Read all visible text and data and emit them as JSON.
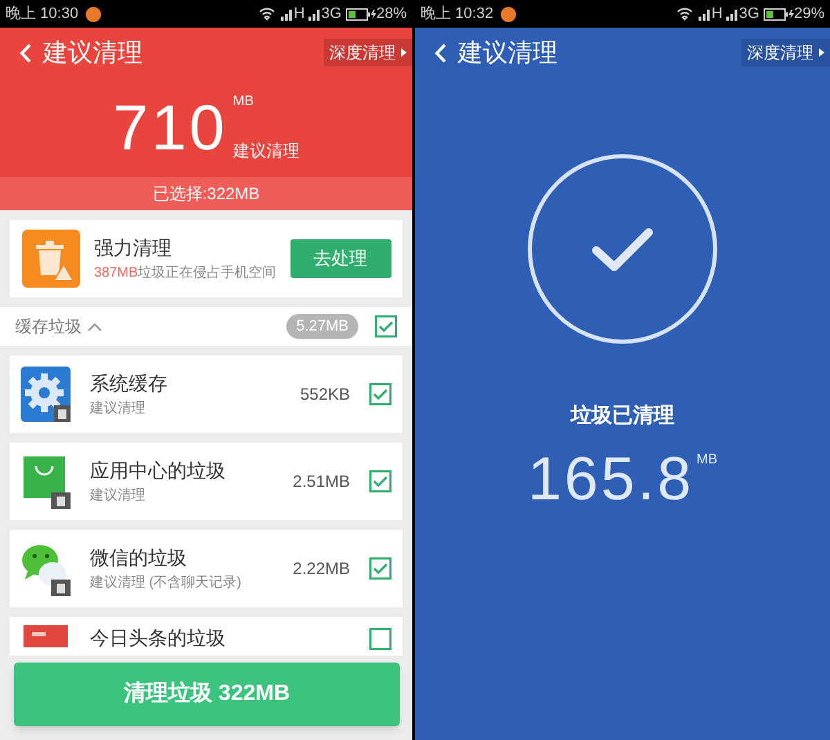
{
  "scan_screen": {
    "status_bar": {
      "time": "晚上 10:30",
      "network_1": "H",
      "network_2": "3G",
      "battery": "28%"
    },
    "header": {
      "title": "建议清理",
      "deep_clean_link": "深度清理",
      "total": "710",
      "total_unit": "MB",
      "total_caption": "建议清理",
      "selected_summary": "已选择:322MB"
    },
    "power_clean": {
      "title": "强力清理",
      "size": "387MB",
      "description": "垃圾正在侵占手机空间",
      "button": "去处理"
    },
    "section": {
      "title": "缓存垃圾",
      "expanded": true,
      "size": "5.27MB",
      "checked": true
    },
    "items": [
      {
        "kind": "gear",
        "title": "系统缓存",
        "subtitle": "建议清理",
        "size": "552KB",
        "checked": true
      },
      {
        "kind": "bag",
        "title": "应用中心的垃圾",
        "subtitle": "建议清理",
        "size": "2.51MB",
        "checked": true
      },
      {
        "kind": "chat",
        "title": "微信的垃圾",
        "subtitle": "建议清理 (不含聊天记录)",
        "size": "2.22MB",
        "checked": true
      },
      {
        "kind": "news",
        "title": "今日头条的垃圾",
        "checked": false
      }
    ],
    "clean_button": "清理垃圾 322MB"
  },
  "done_screen": {
    "status_bar": {
      "time": "晚上 10:32",
      "network_1": "H",
      "network_2": "3G",
      "battery": "29%"
    },
    "header": {
      "title": "建议清理",
      "deep_clean_link": "深度清理"
    },
    "result_title": "垃圾已清理",
    "cleaned": "165.8",
    "cleaned_unit": "MB"
  }
}
